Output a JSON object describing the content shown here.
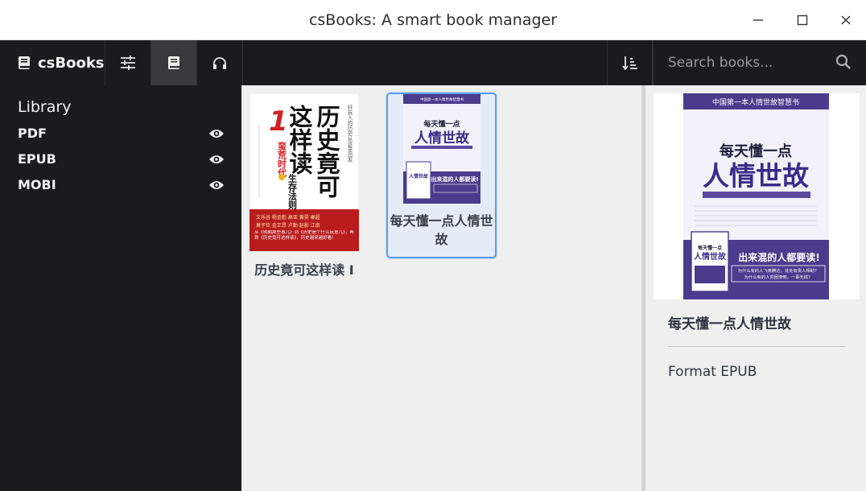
{
  "window": {
    "title": "csBooks: A smart book manager"
  },
  "toolbar": {
    "brand": "csBooks",
    "search_placeholder": "Search books..."
  },
  "sidebar": {
    "heading": "Library",
    "items": [
      {
        "label": "PDF",
        "icon": "eye-icon"
      },
      {
        "label": "EPUB",
        "icon": "eye-icon"
      },
      {
        "label": "MOBI",
        "icon": "eye-icon"
      }
    ]
  },
  "books": [
    {
      "title": "历史竟可这样读 I",
      "selected": false,
      "cover": {
        "side_text": "好玩人的历史从这里出发",
        "big_text": [
          "这样读",
          "历史竟可"
        ],
        "number": "1",
        "sub_text": [
          "蛮荒时代",
          "生存法则"
        ],
        "footer_text": "从《明朝那些事儿》到《历史是个什么玩意儿》，再到《历史竟可这样读》，历史越来越好看！"
      }
    },
    {
      "title": "每天懂一点人情世故",
      "selected": true,
      "cover": {
        "top_text": "中国第一本人情世故智慧书",
        "title_lines": [
          "每天懂一点",
          "人情世故"
        ],
        "slogan": "出来混的人都要读!"
      }
    }
  ],
  "details": {
    "title": "每天懂一点人情世故",
    "format": "Format EPUB",
    "cover": {
      "top_text": "中国第一本人情世故智慧书",
      "title_lines": [
        "每天懂一点",
        "人情世故"
      ],
      "slogan": "出来混的人都要读!",
      "sub_slogan": [
        "为什么有的人飞黄腾达，处处有贵人相助？",
        "为什么有的人穷困潦倒，一事无成？"
      ]
    }
  },
  "colors": {
    "toolbar_bg": "#1b1b1d",
    "content_bg": "#efefef",
    "selection_border": "#5b9cf0",
    "cover_purple": "#4a3b8c",
    "cover_red": "#c81e1e"
  }
}
